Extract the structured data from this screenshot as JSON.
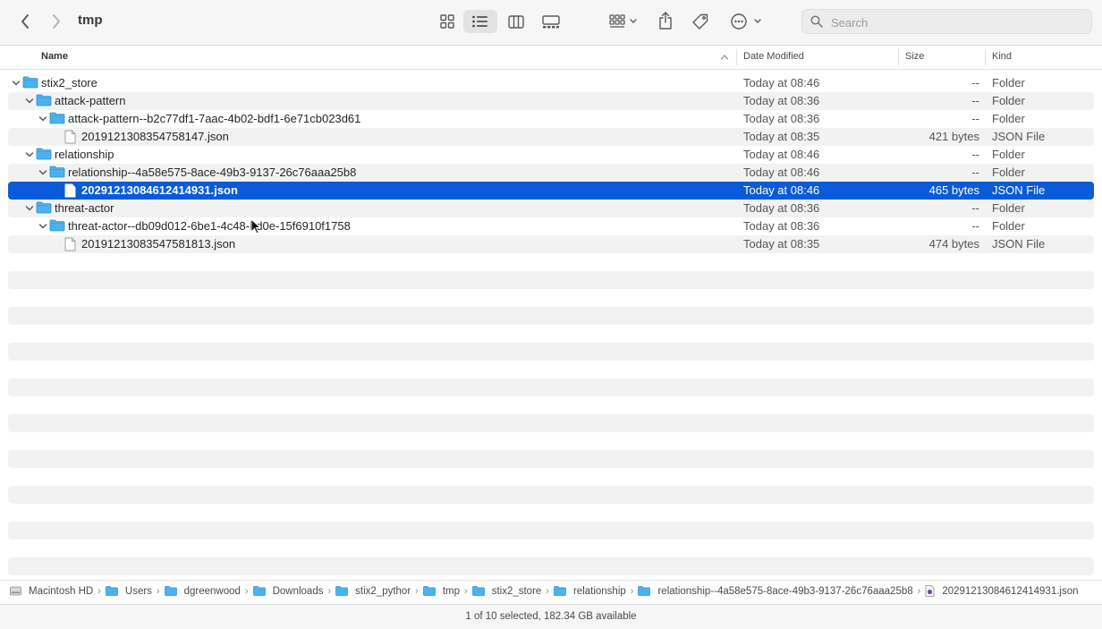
{
  "window": {
    "title": "tmp"
  },
  "toolbar": {
    "icons": [
      "back-icon",
      "forward-icon",
      "icon-view-icon",
      "list-view-icon",
      "column-view-icon",
      "gallery-view-icon",
      "group-icon",
      "share-icon",
      "tag-icon",
      "more-icon"
    ]
  },
  "search": {
    "placeholder": "Search",
    "value": ""
  },
  "columns": {
    "name": "Name",
    "date": "Date Modified",
    "size": "Size",
    "kind": "Kind"
  },
  "rows": [
    {
      "name": "stix2_store",
      "date": "Today at 08:46",
      "size": "--",
      "kind": "Folder",
      "type": "folder",
      "depth": 0,
      "expanded": true
    },
    {
      "name": "attack-pattern",
      "date": "Today at 08:36",
      "size": "--",
      "kind": "Folder",
      "type": "folder",
      "depth": 1,
      "expanded": true
    },
    {
      "name": "attack-pattern--b2c77df1-7aac-4b02-bdf1-6e71cb023d61",
      "date": "Today at 08:36",
      "size": "--",
      "kind": "Folder",
      "type": "folder",
      "depth": 2,
      "expanded": true
    },
    {
      "name": "2019121308354758147.json",
      "date": "Today at 08:35",
      "size": "421 bytes",
      "kind": "JSON File",
      "type": "file",
      "depth": 3
    },
    {
      "name": "relationship",
      "date": "Today at 08:46",
      "size": "--",
      "kind": "Folder",
      "type": "folder",
      "depth": 1,
      "expanded": true
    },
    {
      "name": "relationship--4a58e575-8ace-49b3-9137-26c76aaa25b8",
      "date": "Today at 08:46",
      "size": "--",
      "kind": "Folder",
      "type": "folder",
      "depth": 2,
      "expanded": true
    },
    {
      "name": "20291213084612414931.json",
      "date": "Today at 08:46",
      "size": "465 bytes",
      "kind": "JSON File",
      "type": "file",
      "depth": 3,
      "selected": true
    },
    {
      "name": "threat-actor",
      "date": "Today at 08:36",
      "size": "--",
      "kind": "Folder",
      "type": "folder",
      "depth": 1,
      "expanded": true
    },
    {
      "name": "threat-actor--db09d012-6be1-4c48-bd0e-15f6910f1758",
      "date": "Today at 08:36",
      "size": "--",
      "kind": "Folder",
      "type": "folder",
      "depth": 2,
      "expanded": true
    },
    {
      "name": "20191213083547581813.json",
      "date": "Today at 08:35",
      "size": "474 bytes",
      "kind": "JSON File",
      "type": "file",
      "depth": 3
    }
  ],
  "path": [
    "Macintosh HD",
    "Users",
    "dgreenwood",
    "Downloads",
    "stix2_pythor",
    "tmp",
    "stix2_store",
    "relationship",
    "relationship--4a58e575-8ace-49b3-9137-26c76aaa25b8",
    "20291213084612414931.json"
  ],
  "status": "1 of 10 selected, 182.34 GB available",
  "colors": {
    "selection": "#0a5bd9",
    "folder": "#4ab2f0",
    "stripe": "#f2f2f2"
  }
}
